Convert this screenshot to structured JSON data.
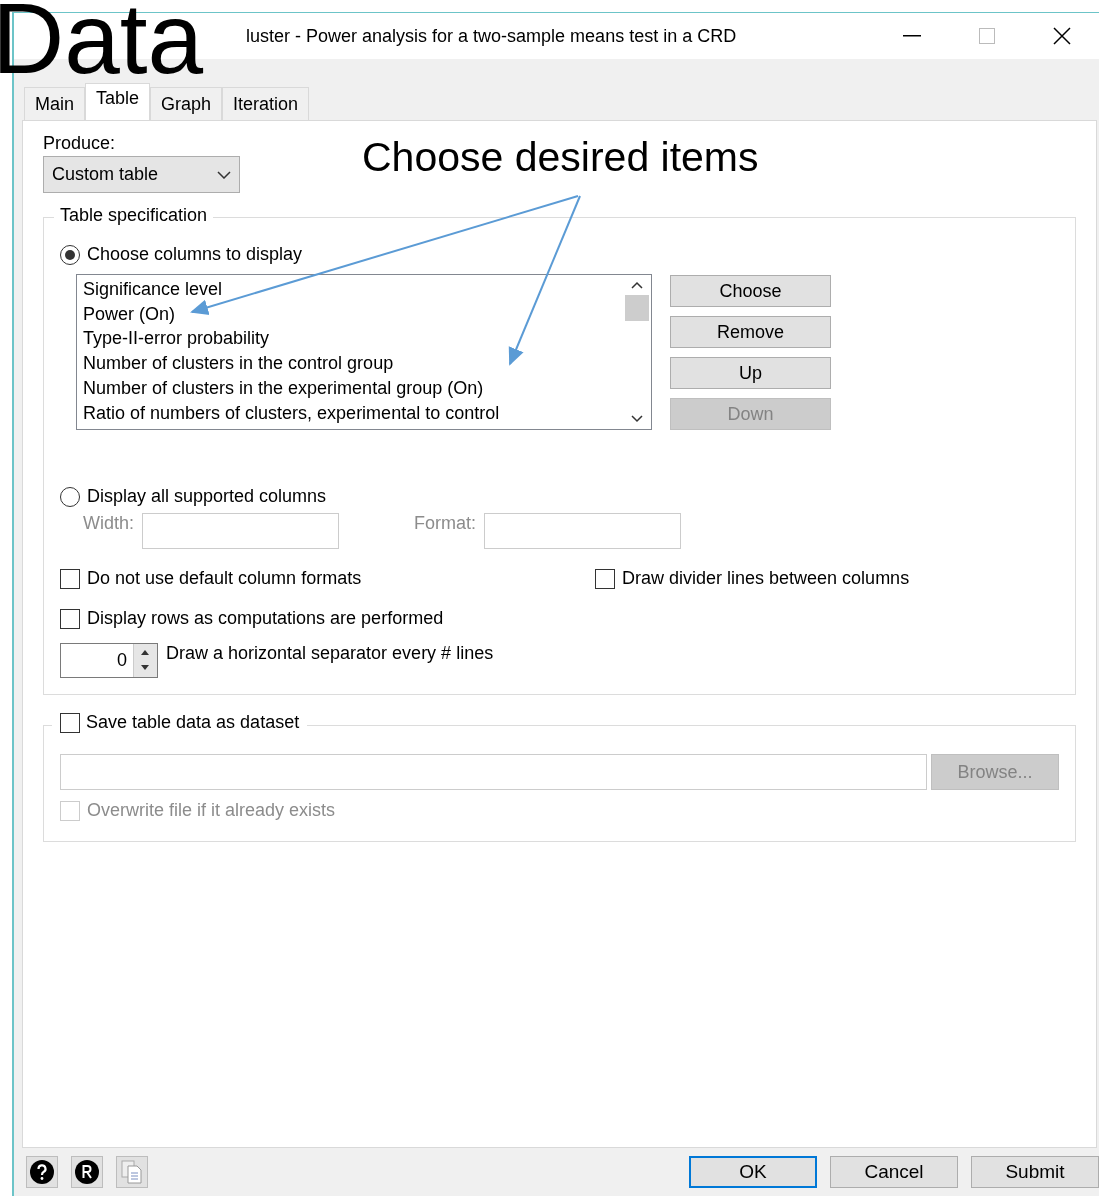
{
  "slide_title": "Data",
  "window": {
    "title": "luster - Power analysis for a two-sample means test in a CRD"
  },
  "tabs": [
    {
      "label": "Main",
      "selected": false
    },
    {
      "label": "Table",
      "selected": true
    },
    {
      "label": "Graph",
      "selected": false
    },
    {
      "label": "Iteration",
      "selected": false
    }
  ],
  "produce": {
    "label": "Produce:",
    "value": "Custom table"
  },
  "annotation": "Choose desired items",
  "table_spec": {
    "legend": "Table specification",
    "choose_radio": {
      "label": "Choose columns to display",
      "selected": true
    },
    "columns": [
      "Significance level",
      "Power (On)",
      "Type-II-error probability",
      "Number of clusters in the control group",
      "Number of clusters in the experimental group (On)",
      "Ratio of numbers of clusters, experimental to control"
    ],
    "buttons": [
      {
        "label": "Choose",
        "disabled": false
      },
      {
        "label": "Remove",
        "disabled": false
      },
      {
        "label": "Up",
        "disabled": false
      },
      {
        "label": "Down",
        "disabled": true
      }
    ],
    "all_radio": {
      "label": "Display all supported columns",
      "selected": false
    },
    "width": {
      "label": "Width:",
      "disabled": true
    },
    "format": {
      "label": "Format:",
      "disabled": true
    },
    "checkboxes": [
      {
        "label": "Do not use default column formats",
        "checked": false
      },
      {
        "label": "Draw divider lines between columns",
        "checked": false
      },
      {
        "label": "Display rows as computations are performed",
        "checked": false
      }
    ],
    "separator": {
      "value": "0",
      "label": "Draw a horizontal separator every # lines"
    }
  },
  "save": {
    "label": "Save table data as dataset",
    "checked": false,
    "browse": {
      "label": "Browse...",
      "disabled": true
    },
    "overwrite": {
      "label": "Overwrite file if it already exists",
      "checked": false,
      "disabled": true
    }
  },
  "footer_buttons": [
    {
      "label": "OK",
      "default": true
    },
    {
      "label": "Cancel",
      "default": false
    },
    {
      "label": "Submit",
      "default": false
    }
  ]
}
